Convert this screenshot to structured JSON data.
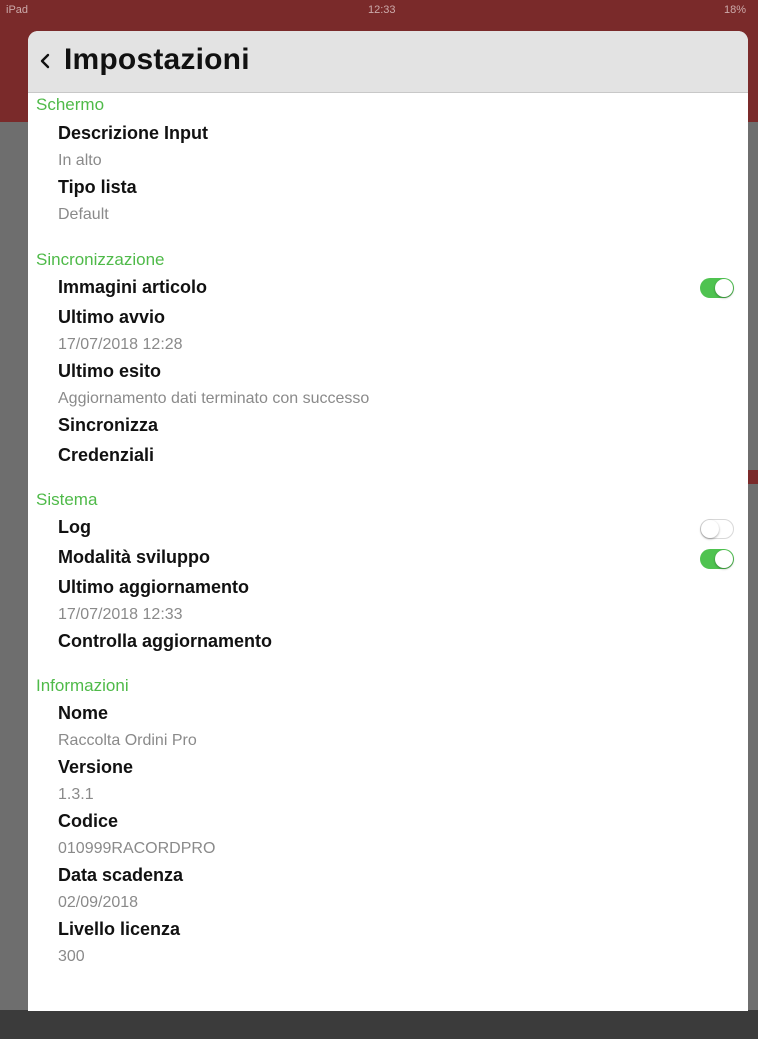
{
  "background": {
    "status_left": "iPad",
    "status_time": "12:33",
    "status_battery": "18%"
  },
  "nav": {
    "title": "Impostazioni"
  },
  "sections": {
    "schermo": {
      "header": "Schermo",
      "descrizione_label": "Descrizione Input",
      "descrizione_value": "In alto",
      "tipo_label": "Tipo lista",
      "tipo_value": "Default"
    },
    "sincronizzazione": {
      "header": "Sincronizzazione",
      "immagini_label": "Immagini articolo",
      "immagini_on": true,
      "avvio_label": "Ultimo avvio",
      "avvio_value": "17/07/2018 12:28",
      "esito_label": "Ultimo esito",
      "esito_value": "Aggiornamento dati terminato con successo",
      "sincronizza_label": "Sincronizza",
      "credenziali_label": "Credenziali"
    },
    "sistema": {
      "header": "Sistema",
      "log_label": "Log",
      "log_on": false,
      "sviluppo_label": "Modalità sviluppo",
      "sviluppo_on": true,
      "aggiornamento_label": "Ultimo aggiornamento",
      "aggiornamento_value": "17/07/2018 12:33",
      "controlla_label": "Controlla aggiornamento"
    },
    "informazioni": {
      "header": "Informazioni",
      "nome_label": "Nome",
      "nome_value": "Raccolta Ordini Pro",
      "versione_label": "Versione",
      "versione_value": "1.3.1",
      "codice_label": "Codice",
      "codice_value": "010999RACORDPRO",
      "scadenza_label": "Data scadenza",
      "scadenza_value": "02/09/2018",
      "licenza_label": "Livello licenza",
      "licenza_value": "300"
    }
  },
  "colors": {
    "section_header": "#4fba49",
    "toggle_on": "#4fc350",
    "value_text": "#8a8a8a"
  }
}
